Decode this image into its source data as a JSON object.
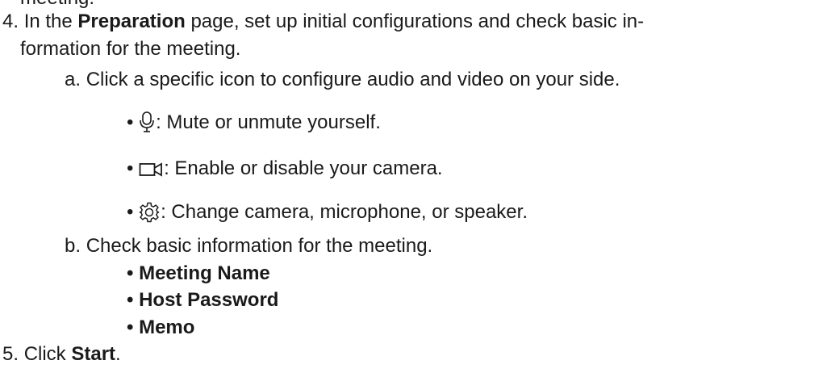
{
  "steps": {
    "prev_fragment": "meeting.",
    "step4": {
      "number": "4.",
      "text_before": "In the",
      "page_name": "Preparation",
      "text_after": "page, set up initial configurations and check basic in-",
      "continuation": "formation for the meeting.",
      "sub_a": {
        "label": "a.",
        "text": "Click a specific icon to configure audio and video on your side.",
        "items": [
          {
            "icon": "microphone-icon",
            "bullet": "•",
            "text": ": Mute or unmute yourself."
          },
          {
            "icon": "camera-icon",
            "bullet": "•",
            "text": ": Enable or disable your camera."
          },
          {
            "icon": "gear-icon",
            "bullet": "•",
            "text": ": Change camera, microphone, or speaker."
          }
        ]
      },
      "sub_b": {
        "label": "b.",
        "text": "Check basic information for the meeting.",
        "items": [
          {
            "bullet": "•",
            "text": "Meeting Name"
          },
          {
            "bullet": "•",
            "text": "Host Password"
          },
          {
            "bullet": "•",
            "text": "Memo"
          }
        ]
      }
    },
    "step5": {
      "number": "5.",
      "text_before": "Click",
      "button_name": "Start",
      "text_after": "."
    }
  }
}
